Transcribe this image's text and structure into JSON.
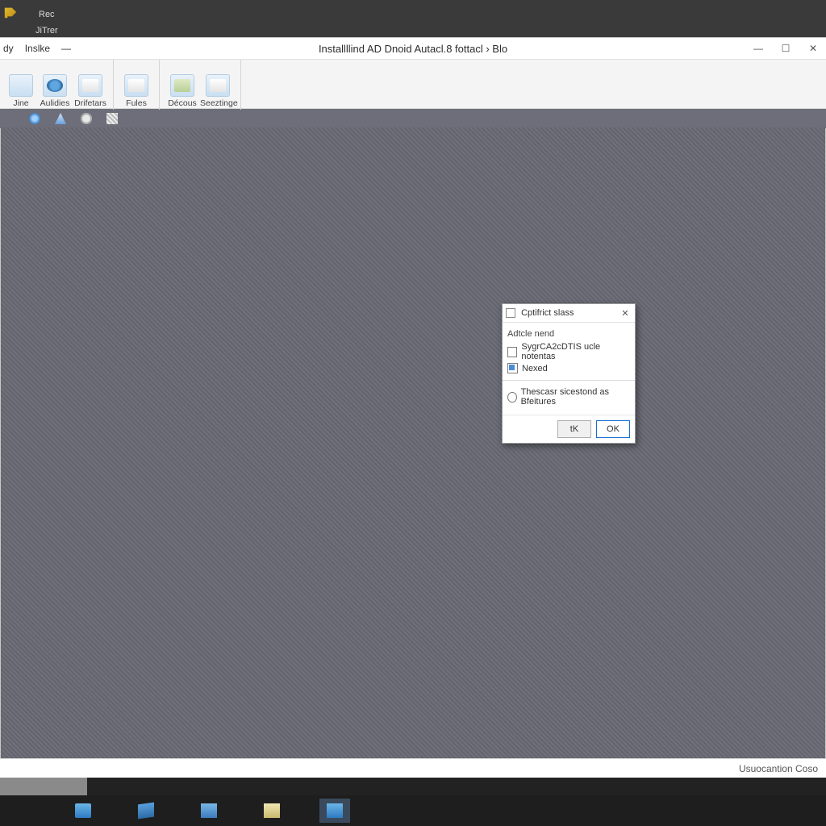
{
  "os_top": {
    "label1": "Rec",
    "label2": "JiTrer"
  },
  "titlebar": {
    "menu": {
      "item1": "dy",
      "item2": "Inslke",
      "min_glyph": "—"
    },
    "title": "Installllind AD Dnoid Autacl.8 fottacl  ›  Blo",
    "controls": {
      "min": "—",
      "max": "☐",
      "close": "✕"
    }
  },
  "ribbon": {
    "g1": {
      "i1": "Jine",
      "i2": "Aulidies",
      "i3": "Drifetars"
    },
    "g2": {
      "i1": "Fules"
    },
    "g3": {
      "i1": "Décous",
      "i2": "Seeztinge"
    }
  },
  "dialog": {
    "title": "Cptifrict slass",
    "section_label": "Adtcle nend",
    "opt1": "SygrCA2cDTIS ucle notentas",
    "opt2": "Nexed",
    "opt3": "Thescasr sicestond as Bfeitures",
    "btn_cancel": "tK",
    "btn_ok": "OK"
  },
  "status": {
    "right_label": "Usuocantion Coso"
  }
}
